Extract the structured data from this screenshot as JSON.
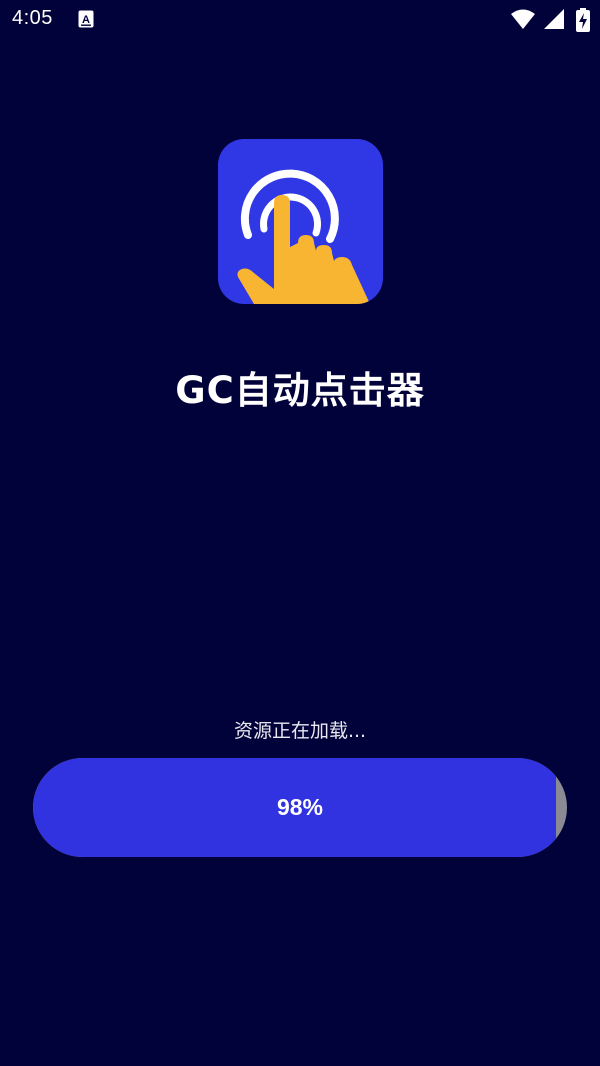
{
  "status_bar": {
    "time": "4:05",
    "notification_icon": "a-text-icon",
    "icons": [
      "wifi-icon",
      "signal-icon",
      "battery-charging-icon"
    ]
  },
  "app": {
    "icon": "tap-touch-icon",
    "icon_bg_color": "#3038e6",
    "hand_color": "#f8b531",
    "title": "GC自动点击器"
  },
  "loading": {
    "message": "资源正在加载...",
    "progress_label": "98%",
    "progress_fraction": 0.98,
    "fill_color": "#3132e0",
    "track_color": "#8a8a94"
  },
  "colors": {
    "background": "#02023a"
  }
}
